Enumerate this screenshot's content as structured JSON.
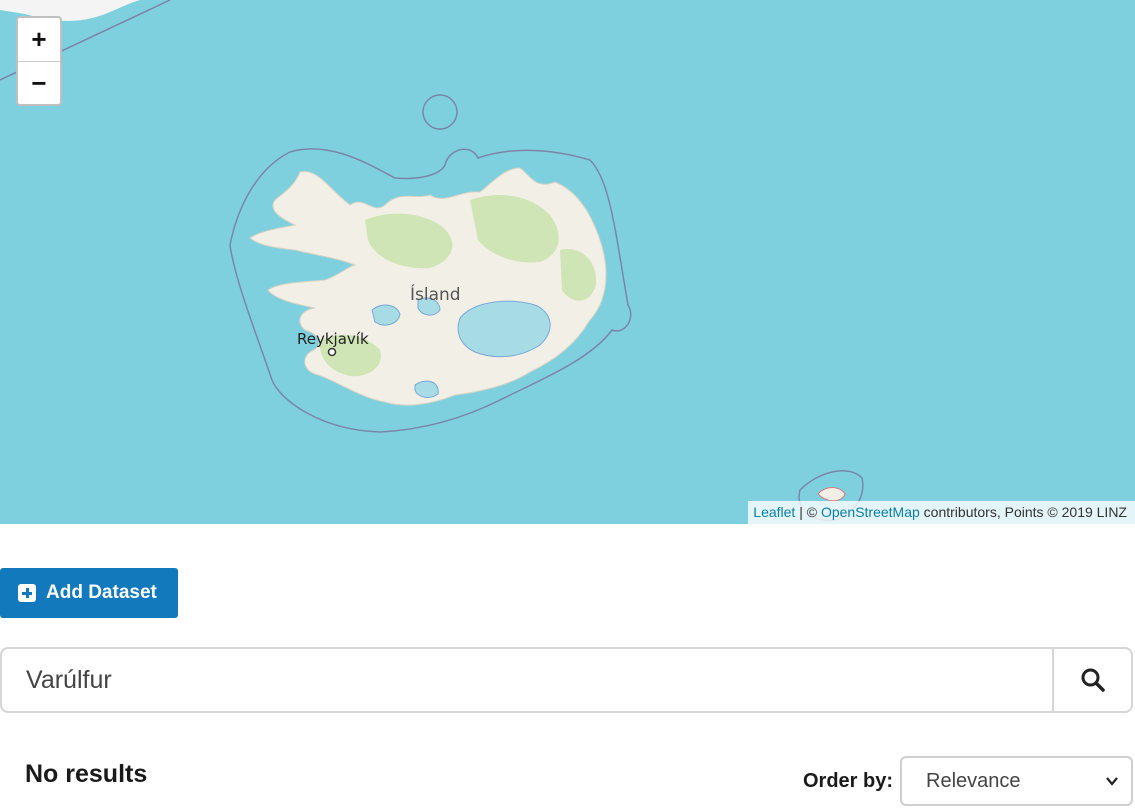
{
  "map": {
    "labels": {
      "country": "Ísland",
      "capital": "Reykjavík"
    },
    "zoom_in": "+",
    "zoom_out": "−",
    "attribution": {
      "leaflet": "Leaflet",
      "separator": " | © ",
      "osm": "OpenStreetMap",
      "rest": " contributors, Points © 2019 LINZ"
    },
    "colors": {
      "water": "#7fd0de",
      "land": "#f2efe6",
      "green": "#c9e3ad",
      "glacier": "#a7dbe5",
      "border": "#7a86a8"
    }
  },
  "toolbar": {
    "add_dataset_label": "Add Dataset",
    "add_icon": "plus-square-icon"
  },
  "search": {
    "value": "Varúlfur",
    "icon": "search-icon"
  },
  "results": {
    "status": "No results",
    "order_label": "Order by:",
    "order_selected": "Relevance",
    "order_icon": "chevron-down-icon"
  },
  "colors": {
    "primary": "#1379bd"
  }
}
